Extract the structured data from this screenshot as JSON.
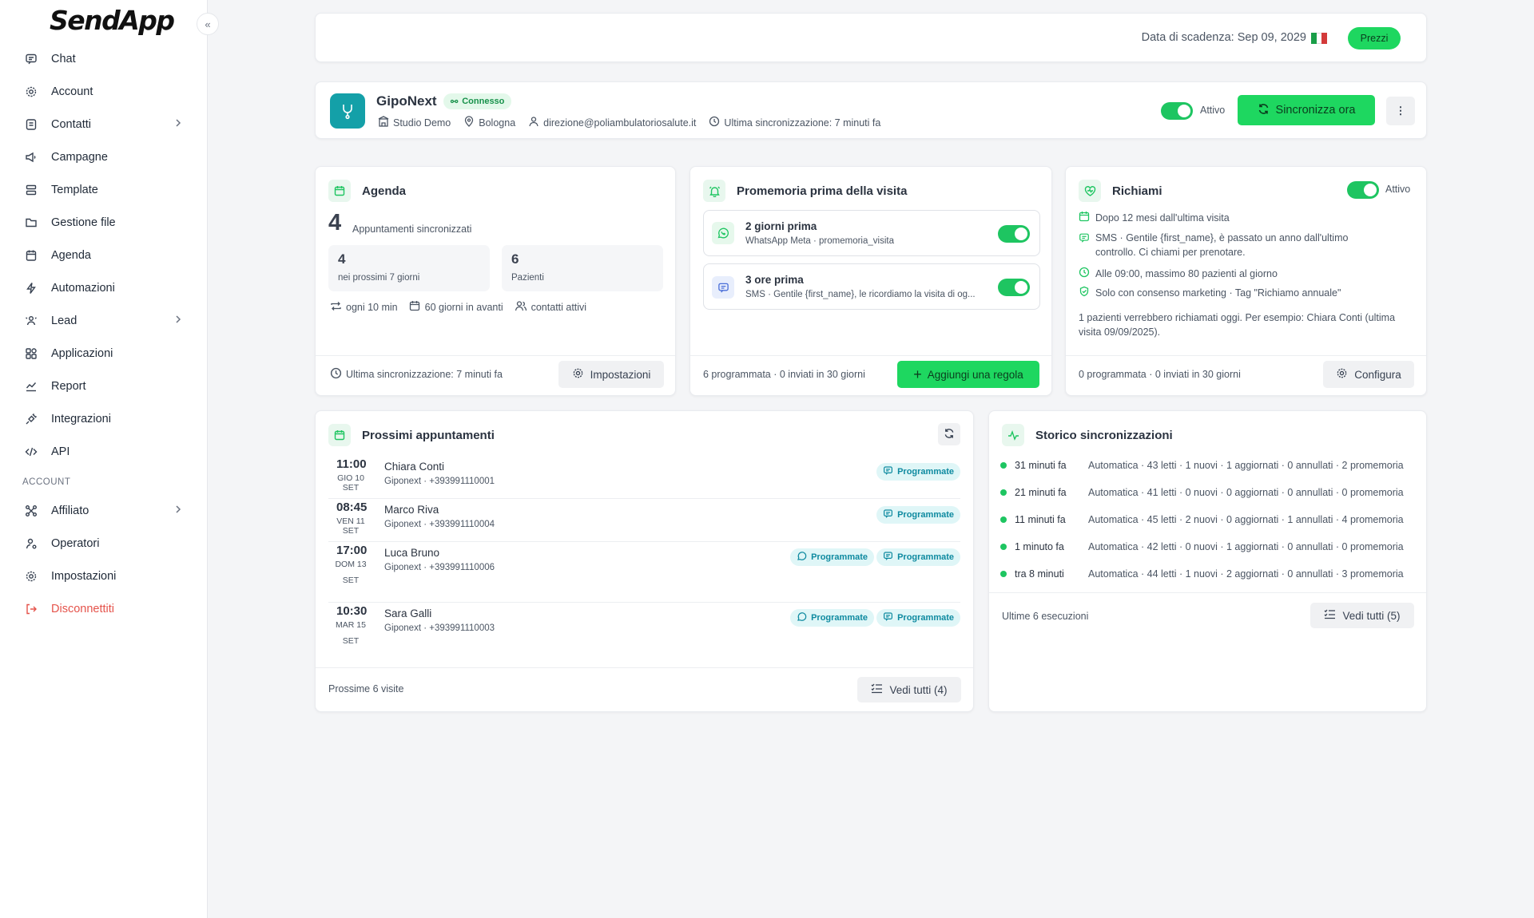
{
  "brand": "SendApp",
  "sidebar": {
    "items": [
      {
        "label": "Chat",
        "icon": "chat-icon"
      },
      {
        "label": "Account",
        "icon": "gear-icon"
      },
      {
        "label": "Contatti",
        "icon": "contacts-icon"
      },
      {
        "label": "Campagne",
        "icon": "campaign-icon"
      },
      {
        "label": "Template",
        "icon": "template-icon"
      },
      {
        "label": "Gestione file",
        "icon": "folder-icon"
      },
      {
        "label": "Agenda",
        "icon": "calendar-icon"
      },
      {
        "label": "Automazioni",
        "icon": "bolt-icon"
      },
      {
        "label": "Lead",
        "icon": "lead-icon"
      },
      {
        "label": "Applicazioni",
        "icon": "apps-icon"
      },
      {
        "label": "Report",
        "icon": "report-icon"
      },
      {
        "label": "Integrazioni",
        "icon": "plug-icon"
      },
      {
        "label": "API",
        "icon": "code-icon"
      }
    ],
    "section": "ACCOUNT",
    "account_items": [
      {
        "label": "Affiliato",
        "icon": "affiliate-icon"
      },
      {
        "label": "Operatori",
        "icon": "user-gear-icon"
      },
      {
        "label": "Impostazioni",
        "icon": "gear-icon"
      },
      {
        "label": "Disconnettiti",
        "icon": "logout-icon"
      }
    ]
  },
  "topbar": {
    "expiry": "Data di scadenza: Sep 09, 2029",
    "price_button": "Prezzi"
  },
  "integration": {
    "name": "GipoNext",
    "status": "Connesso",
    "studio": "Studio Demo",
    "city": "Bologna",
    "email": "direzione@poliambulatoriosalute.it",
    "last_sync": "Ultima sincronizzazione: 7 minuti fa",
    "toggle_label": "Attivo",
    "sync_button": "Sincronizza ora"
  },
  "agenda": {
    "title": "Agenda",
    "count": "4",
    "count_label": "Appuntamenti sincronizzati",
    "stat1_value": "4",
    "stat1_label": "nei prossimi 7 giorni",
    "stat2_value": "6",
    "stat2_label": "Pazienti",
    "meta1": "ogni 10 min",
    "meta2": "60 giorni in avanti",
    "meta3": "contatti attivi",
    "footer": "Ultima sincronizzazione: 7 minuti fa",
    "button": "Impostazioni"
  },
  "reminders": {
    "title": "Promemoria prima della visita",
    "rules": [
      {
        "title": "2 giorni prima",
        "sub": "WhatsApp Meta · promemoria_visita"
      },
      {
        "title": "3 ore prima",
        "sub": "SMS · Gentile {first_name}, le ricordiamo la visita di og..."
      }
    ],
    "footer": "6 programmata · 0 inviati in 30 giorni",
    "button": "Aggiungi una regola"
  },
  "recall": {
    "title": "Richiami",
    "toggle_label": "Attivo",
    "line1": "Dopo 12 mesi dall'ultima visita",
    "line2a": "SMS · Gentile {first_name}, è passato un anno dall'ultimo",
    "line2b": "controllo. Ci chiami per prenotare.",
    "line3": "Alle 09:00, massimo 80 pazienti al giorno",
    "line4": "Solo con consenso marketing · Tag \"Richiamo annuale\"",
    "note_a": "1 pazienti verrebbero richiamati oggi. Per esempio: Chiara Conti (ultima",
    "note_b": "visita 09/09/2025).",
    "footer": "0 programmata · 0 inviati in 30 giorni",
    "button": "Configura"
  },
  "upcoming": {
    "title": "Prossimi appuntamenti",
    "rows": [
      {
        "time": "11:00",
        "date1": "GIO 10 SET",
        "date2": "",
        "name": "Chiara Conti",
        "sub": "Giponext · +393991110001",
        "tags": [
          "sms"
        ]
      },
      {
        "time": "08:45",
        "date1": "VEN 11 SET",
        "date2": "",
        "name": "Marco Riva",
        "sub": "Giponext · +393991110004",
        "tags": [
          "sms"
        ]
      },
      {
        "time": "17:00",
        "date1": "DOM 13",
        "date2": "SET",
        "name": "Luca Bruno",
        "sub": "Giponext · +393991110006",
        "tags": [
          "wa",
          "sms"
        ]
      },
      {
        "time": "10:30",
        "date1": "MAR 15",
        "date2": "SET",
        "name": "Sara Galli",
        "sub": "Giponext · +393991110003",
        "tags": [
          "wa",
          "sms"
        ]
      }
    ],
    "tag_label": "Programmate",
    "footer": "Prossime 6 visite",
    "button": "Vedi tutti (4)"
  },
  "history": {
    "title": "Storico sincronizzazioni",
    "rows": [
      {
        "when": "31 minuti fa",
        "detail": "Automatica · 43 letti · 1 nuovi · 1 aggiornati · 0 annullati · 2 promemoria"
      },
      {
        "when": "21 minuti fa",
        "detail": "Automatica · 41 letti · 0 nuovi · 0 aggiornati · 0 annullati · 0 promemoria"
      },
      {
        "when": "11 minuti fa",
        "detail": "Automatica · 45 letti · 2 nuovi · 0 aggiornati · 1 annullati · 4 promemoria"
      },
      {
        "when": "1 minuto fa",
        "detail": "Automatica · 42 letti · 0 nuovi · 1 aggiornati · 0 annullati · 0 promemoria"
      },
      {
        "when": "tra 8 minuti",
        "detail": "Automatica · 44 letti · 1 nuovi · 2 aggiornati · 0 annullati · 3 promemoria"
      }
    ],
    "footer": "Ultime 6 esecuzioni",
    "button": "Vedi tutti (5)"
  }
}
